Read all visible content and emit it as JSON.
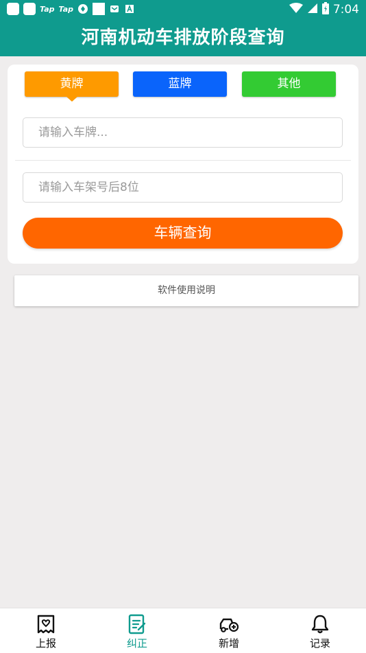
{
  "status_bar": {
    "tap_1": "Tap",
    "tap_2": "Tap",
    "time": "7:04"
  },
  "app_bar": {
    "title": "河南机动车排放阶段查询"
  },
  "plate_types": [
    {
      "label": "黄牌",
      "color": "#fe9a00",
      "selected": true
    },
    {
      "label": "蓝牌",
      "color": "#0a64fb",
      "selected": false
    },
    {
      "label": "其他",
      "color": "#33cb33",
      "selected": false
    }
  ],
  "form": {
    "plate_placeholder": "请输入车牌...",
    "plate_value": "",
    "vin_placeholder": "请输入车架号后8位",
    "vin_value": "",
    "query_label": "车辆查询"
  },
  "help": {
    "label": "软件使用说明"
  },
  "bottom_nav": [
    {
      "label": "上报",
      "icon": "report-icon",
      "active": false
    },
    {
      "label": "纠正",
      "icon": "correct-icon",
      "active": true
    },
    {
      "label": "新增",
      "icon": "add-vehicle-icon",
      "active": false
    },
    {
      "label": "记录",
      "icon": "bell-icon",
      "active": false
    }
  ],
  "colors": {
    "primary": "#0f9b8e",
    "query_button": "#ff6600",
    "background": "#efeded"
  }
}
